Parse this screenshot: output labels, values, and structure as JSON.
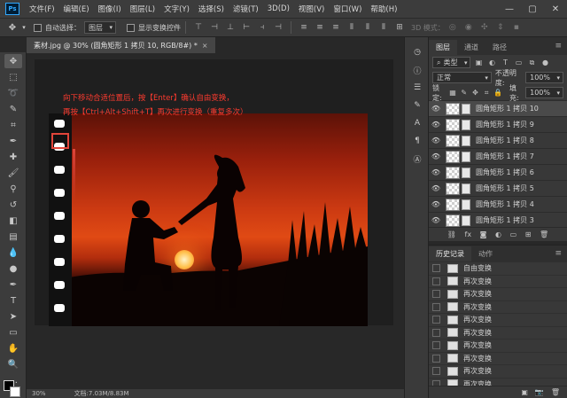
{
  "app": {
    "logo": "Ps"
  },
  "menu": [
    "文件(F)",
    "编辑(E)",
    "图像(I)",
    "图层(L)",
    "文字(Y)",
    "选择(S)",
    "滤镜(T)",
    "3D(D)",
    "视图(V)",
    "窗口(W)",
    "帮助(H)"
  ],
  "window_controls": {
    "minimize": "—",
    "maximize": "▢",
    "close": "✕"
  },
  "options": {
    "auto_select_label": "自动选择：",
    "auto_select_value": "图层",
    "show_transform_label": "显示变换控件",
    "mode_3d_label": "3D 模式："
  },
  "document": {
    "tab_title": "素材.jpg @ 30% (圆角矩形 1 拷贝 10, RGB/8#) *",
    "close": "×",
    "zoom": "30%",
    "doc_size": "文档:7.03M/8.83M"
  },
  "annotation": {
    "line1": "向下移动合适位置后，按【Enter】确认自由变换，",
    "line2": "再按【Ctrl+Alt+Shift+T】再次进行变换（重复多次）"
  },
  "layers_panel": {
    "tabs": [
      "图层",
      "通道",
      "路径"
    ],
    "filter_label": "类型",
    "blend_mode": "正常",
    "opacity_label": "不透明度:",
    "opacity_value": "100%",
    "lock_label": "锁定:",
    "fill_label": "填充:",
    "fill_value": "100%",
    "layers": [
      {
        "name": "圆角矩形 1 拷贝 10",
        "selected": true
      },
      {
        "name": "圆角矩形 1 拷贝 9",
        "selected": false
      },
      {
        "name": "圆角矩形 1 拷贝 8",
        "selected": false
      },
      {
        "name": "圆角矩形 1 拷贝 7",
        "selected": false
      },
      {
        "name": "圆角矩形 1 拷贝 6",
        "selected": false
      },
      {
        "name": "圆角矩形 1 拷贝 5",
        "selected": false
      },
      {
        "name": "圆角矩形 1 拷贝 4",
        "selected": false
      },
      {
        "name": "圆角矩形 1 拷贝 3",
        "selected": false
      }
    ]
  },
  "history_panel": {
    "tabs": [
      "历史记录",
      "动作"
    ],
    "items": [
      "自由变换",
      "再次变换",
      "再次变换",
      "再次变换",
      "再次变换",
      "再次变换",
      "再次变换",
      "再次变换",
      "再次变换",
      "再次变换",
      "再次变换"
    ]
  }
}
